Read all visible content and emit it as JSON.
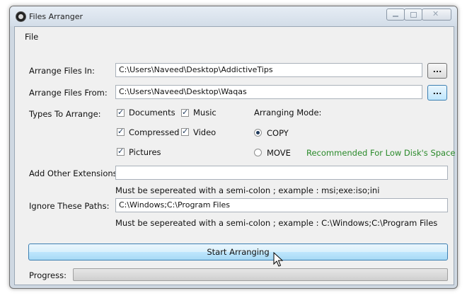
{
  "window": {
    "title": "Files Arranger"
  },
  "menu": {
    "file": "File"
  },
  "form": {
    "arrange_in_label": "Arrange Files In:",
    "arrange_in_value": "C:\\Users\\Naveed\\Desktop\\AddictiveTips",
    "arrange_from_label": "Arrange Files From:",
    "arrange_from_value": "C:\\Users\\Naveed\\Desktop\\Waqas",
    "browse_label": "...",
    "types_label": "Types To Arrange:",
    "types": {
      "documents": "Documents",
      "music": "Music",
      "compressed": "Compressed",
      "video": "Video",
      "pictures": "Pictures"
    },
    "mode_label": "Arranging Mode:",
    "mode_copy": "COPY",
    "mode_move": "MOVE",
    "recommend": "Recommended For Low Disk's Space",
    "other_ext_label": "Add Other Extensions:",
    "other_ext_value": "",
    "ext_hint": "Must be sepereated with a semi-colon ; example : msi;exe:iso;ini",
    "ignore_label": "Ignore These Paths:",
    "ignore_value": "C:\\Windows;C:\\Program Files",
    "ignore_hint": "Must be sepereated with a semi-colon ; example : C:\\Windows;C:\\Program Files",
    "start_label": "Start Arranging",
    "progress_label": "Progress:",
    "progress_value": 0
  },
  "colors": {
    "accent": "#3c7fb1",
    "recommend": "#2a8a2a"
  }
}
